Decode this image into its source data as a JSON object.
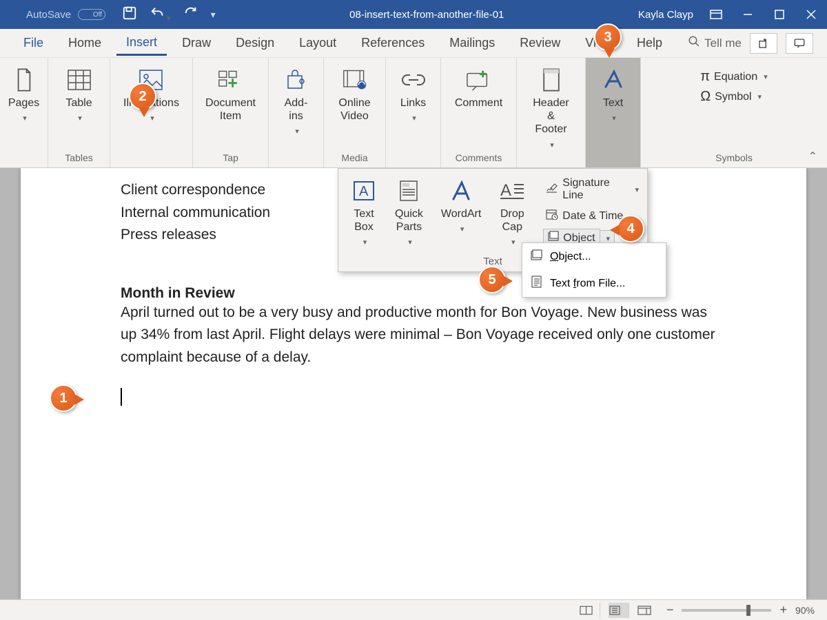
{
  "titlebar": {
    "autosave_label": "AutoSave",
    "autosave_state": "Off",
    "document_title": "08-insert-text-from-another-file-01",
    "user_name": "Kayla Clayp"
  },
  "tabs": {
    "file": "File",
    "home": "Home",
    "insert": "Insert",
    "draw": "Draw",
    "design": "Design",
    "layout": "Layout",
    "references": "References",
    "mailings": "Mailings",
    "review": "Review",
    "view": "View",
    "help": "Help",
    "tellme": "Tell me"
  },
  "ribbon": {
    "pages": {
      "label": "Pages"
    },
    "table": {
      "label": "Table",
      "group": "Tables"
    },
    "illustrations": {
      "label": "Illustrations"
    },
    "document_item": {
      "label": "Document\nItem",
      "group": "Tap"
    },
    "addins": {
      "label": "Add-\nins"
    },
    "online_video": {
      "label": "Online\nVideo",
      "group": "Media"
    },
    "links": {
      "label": "Links"
    },
    "comment": {
      "label": "Comment",
      "group": "Comments"
    },
    "header_footer": {
      "label": "Header &\nFooter"
    },
    "text": {
      "label": "Text"
    },
    "equation": "Equation",
    "symbol": "Symbol",
    "symbols_group": "Symbols"
  },
  "textfly": {
    "text_box": "Text\nBox",
    "quick_parts": "Quick\nParts",
    "wordart": "WordArt",
    "drop_cap": "Drop\nCap",
    "signature_line": "Signature Line",
    "date_time": "Date & Time",
    "object": "Object",
    "group_label": "Text"
  },
  "submenu": {
    "object": "Object...",
    "text_from_file": "Text from File..."
  },
  "document": {
    "list": [
      "Client correspondence",
      "Internal communication",
      "Press releases"
    ],
    "heading": "Month in Review",
    "para": "April turned out to be a very busy and productive month for Bon Voyage. New business was up 34% from last April. Flight delays were minimal – Bon Voyage received only one customer complaint because of a delay."
  },
  "status": {
    "zoom": "90%"
  },
  "callouts": {
    "c1": "1",
    "c2": "2",
    "c3": "3",
    "c4": "4",
    "c5": "5"
  },
  "colors": {
    "brand": "#2b579a",
    "callout": "#e0611f"
  }
}
